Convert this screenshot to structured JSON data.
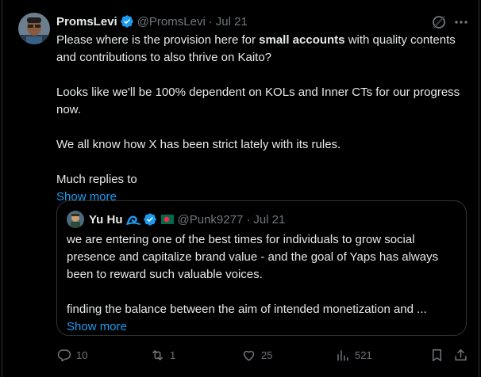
{
  "tweet": {
    "author_name": "PromsLevi",
    "handle": "@PromsLevi",
    "separator": "·",
    "time": "Jul 21",
    "line1_pre": "Please where is the provision here for ",
    "line1_bold": "small accounts",
    "line1_post": " with quality contents and contributions to also thrive on Kaito?",
    "para2": "Looks like we'll be 100% dependent on KOLs and Inner CTs for our progress now.",
    "para3": "We all know how X has been strict lately with its rules.",
    "para4": "Much replies to",
    "show_more": "Show more"
  },
  "quote": {
    "author_name": "Yu Hu",
    "handle": "@Punk9277",
    "separator": "·",
    "time": "Jul 21",
    "para1": "we are entering one of the best times for individuals to grow social presence and capitalize brand value - and the goal of Yaps has always been to reward such valuable voices.",
    "para2": "finding the balance between the aim of intended monetization and ...",
    "show_more": "Show more"
  },
  "actions": {
    "replies": "10",
    "reposts": "1",
    "likes": "25",
    "views": "521"
  },
  "colors": {
    "background": "#000000",
    "text": "#e7e9ea",
    "muted": "#71767b",
    "accent": "#1d9bf0",
    "border": "#2f3336"
  },
  "icons": [
    "verified-badge-icon",
    "grok-icon",
    "more-icon",
    "reply-icon",
    "repost-icon",
    "like-icon",
    "views-icon",
    "bookmark-icon",
    "share-icon",
    "wave-emoji-icon",
    "flag-icon"
  ]
}
